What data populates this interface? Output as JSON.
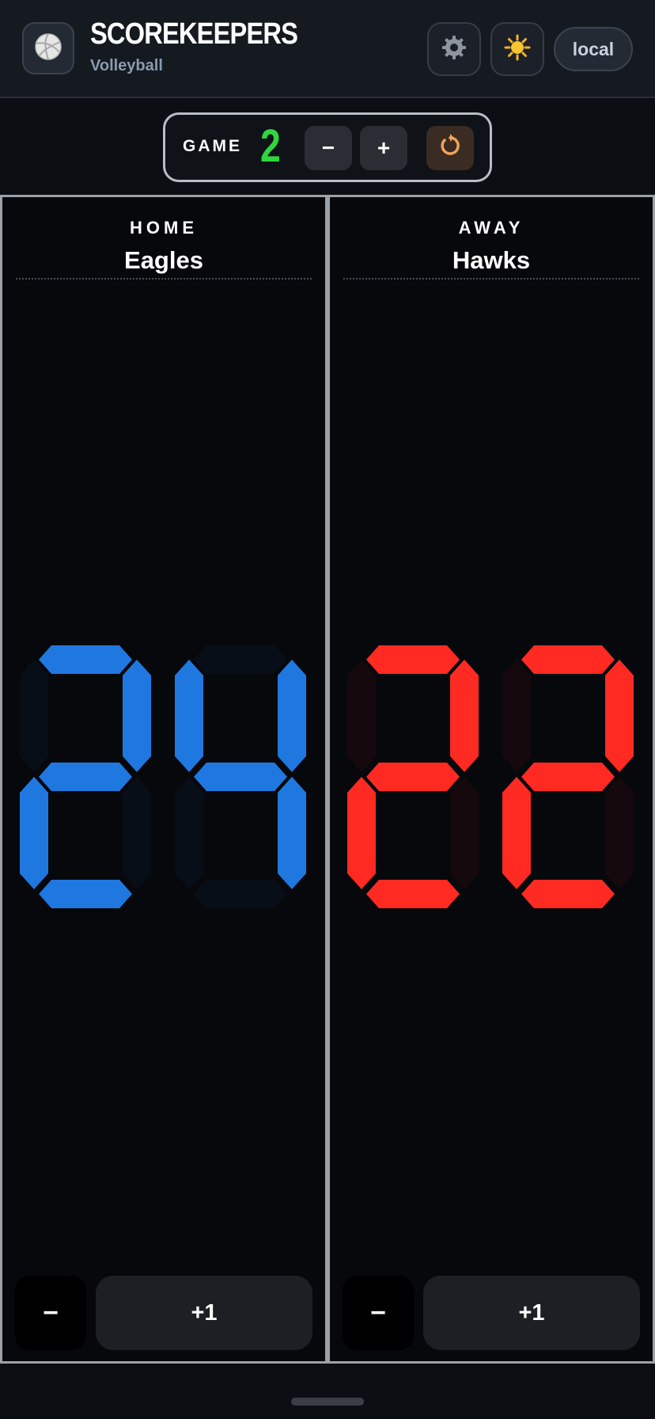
{
  "header": {
    "title": "SCOREKEEPERS",
    "subtitle": "Volleyball",
    "logo_icon": "volleyball-icon",
    "settings_icon": "gear-icon",
    "theme_icon": "sun-icon",
    "mode_label": "local"
  },
  "game": {
    "label": "GAME",
    "value": "2",
    "decrement_label": "−",
    "increment_label": "+",
    "reset_icon": "reset-icon",
    "value_color": "#2fd63d"
  },
  "teams": [
    {
      "side": "HOME",
      "name": "Eagles",
      "score": "24",
      "color": "#1f78e0",
      "minus_label": "−",
      "plus_label": "+1"
    },
    {
      "side": "AWAY",
      "name": "Hawks",
      "score": "22",
      "color": "#ff2a22",
      "minus_label": "−",
      "plus_label": "+1"
    }
  ]
}
